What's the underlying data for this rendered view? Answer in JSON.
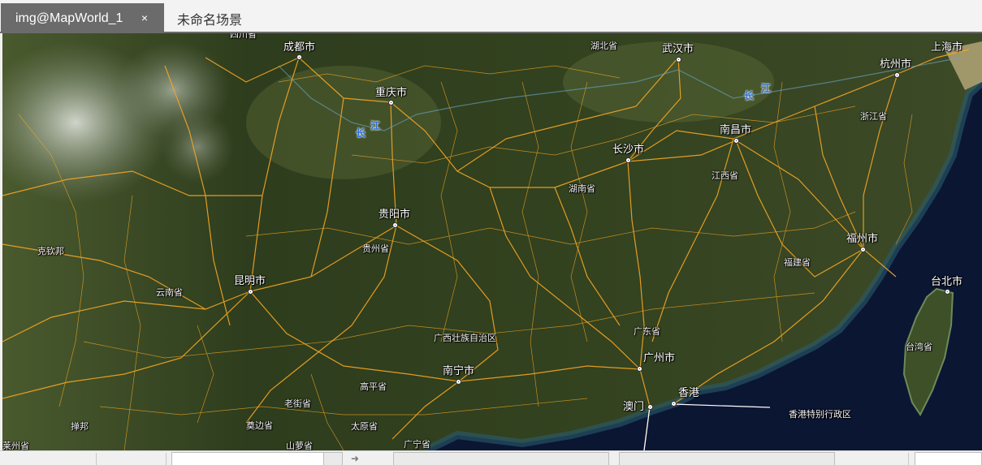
{
  "tabs": [
    {
      "label": "img@MapWorld_1",
      "active": true,
      "close_glyph": "×"
    },
    {
      "label": "未命名场景",
      "active": false
    }
  ],
  "map": {
    "cities": [
      {
        "name": "成都市"
      },
      {
        "name": "武汉市"
      },
      {
        "name": "杭州市"
      },
      {
        "name": "上海市"
      },
      {
        "name": "重庆市"
      },
      {
        "name": "南昌市"
      },
      {
        "name": "长沙市"
      },
      {
        "name": "贵阳市"
      },
      {
        "name": "福州市"
      },
      {
        "name": "昆明市"
      },
      {
        "name": "台北市"
      },
      {
        "name": "广州市"
      },
      {
        "name": "南宁市"
      },
      {
        "name": "香港"
      },
      {
        "name": "澳门"
      }
    ],
    "provinces": [
      {
        "name": "四川省"
      },
      {
        "name": "湖北省"
      },
      {
        "name": "浙江省"
      },
      {
        "name": "江西省"
      },
      {
        "name": "湖南省"
      },
      {
        "name": "贵州省"
      },
      {
        "name": "福建省"
      },
      {
        "name": "克钦邦"
      },
      {
        "name": "云南省"
      },
      {
        "name": "广东省"
      },
      {
        "name": "广西壮族自治区"
      },
      {
        "name": "台湾省"
      },
      {
        "name": "高平省"
      },
      {
        "name": "老街省"
      },
      {
        "name": "掸邦"
      },
      {
        "name": "莱州省"
      },
      {
        "name": "奠边省"
      },
      {
        "name": "太原省"
      },
      {
        "name": "山萝省"
      },
      {
        "name": "广宁省"
      },
      {
        "name": "香港特别行政区"
      }
    ],
    "river_chars": [
      {
        "char": "长"
      },
      {
        "char": "江"
      },
      {
        "char": "长"
      },
      {
        "char": "江"
      }
    ],
    "colors": {
      "road": "#f5a623",
      "land": "#3b4a26",
      "sea": "#0b1633",
      "coast": "#b9aa7c"
    }
  },
  "statusbar": {
    "texts": [
      "",
      "",
      "",
      ""
    ]
  }
}
